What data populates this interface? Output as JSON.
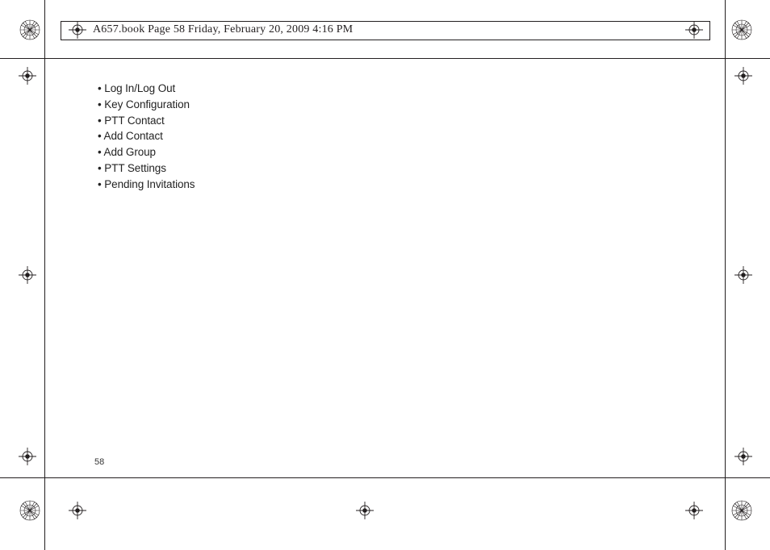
{
  "header": {
    "line": "A657.book  Page 58  Friday, February 20, 2009  4:16 PM"
  },
  "page": {
    "number": "58"
  },
  "bullets": [
    "Log In/Log Out",
    "Key Configuration",
    "PTT Contact",
    "Add Contact",
    "Add Group",
    "PTT Settings",
    "Pending Invitations"
  ]
}
